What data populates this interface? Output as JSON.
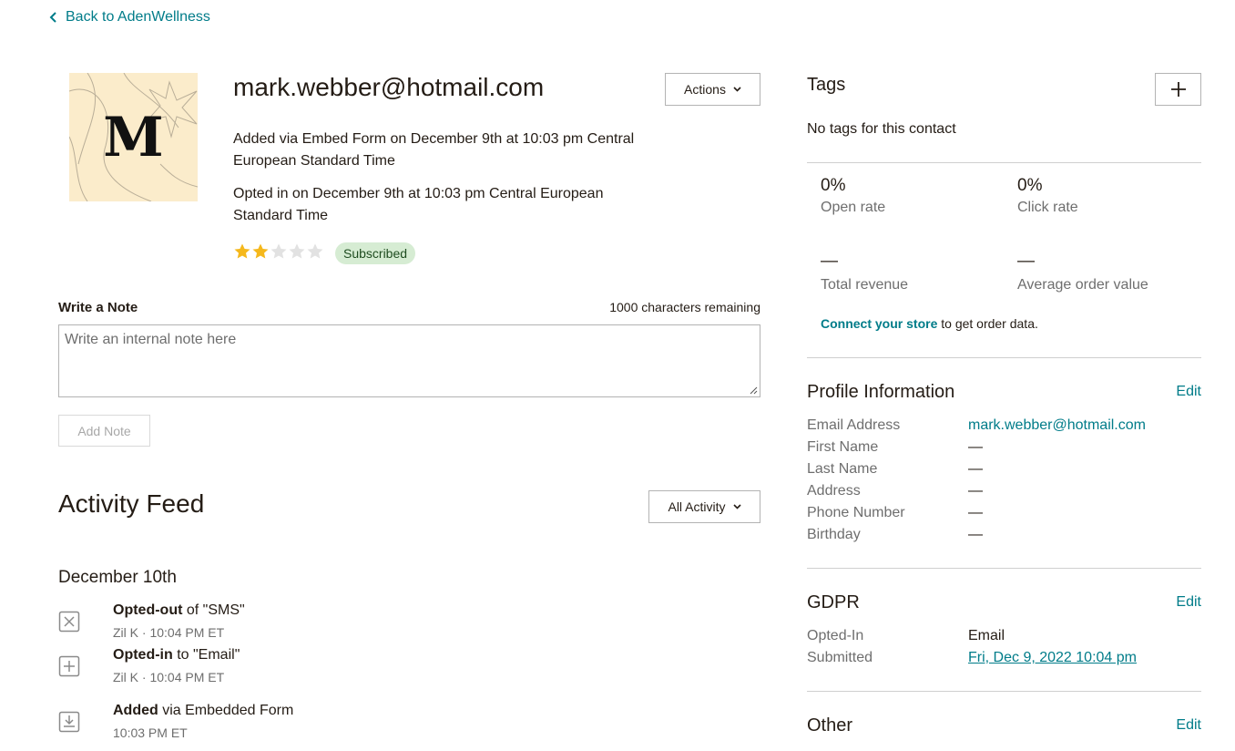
{
  "back_link": "Back to AdenWellness",
  "avatar": {
    "letter": "M"
  },
  "contact": {
    "email": "mark.webber@hotmail.com",
    "added_text": "Added via Embed Form on December 9th at 10:03 pm Central European Standard Time",
    "optin_text": "Opted in on December 9th at 10:03 pm Central European Standard Time",
    "rating": 2,
    "rating_max": 5,
    "status_badge": "Subscribed"
  },
  "actions_label": "Actions",
  "note": {
    "label": "Write a Note",
    "chars_remaining": "1000 characters remaining",
    "placeholder": "Write an internal note here",
    "add_button": "Add Note"
  },
  "activity": {
    "title": "Activity Feed",
    "filter_label": "All Activity",
    "date_heading": "December 10th",
    "items": [
      {
        "icon": "x-box-icon",
        "bold": "Opted-out",
        "rest": " of \"SMS\"",
        "sub": "Zil K · 10:04 PM ET"
      },
      {
        "icon": "plus-box-icon",
        "bold": "Opted-in",
        "rest": " to \"Email\"",
        "sub": "Zil K · 10:04 PM ET"
      },
      {
        "icon": "download-box-icon",
        "bold": "Added",
        "rest": " via Embedded Form",
        "sub": "10:03 PM ET"
      }
    ]
  },
  "tags": {
    "title": "Tags",
    "empty_text": "No tags for this contact"
  },
  "stats": {
    "open_rate": {
      "value": "0%",
      "label": "Open rate"
    },
    "click_rate": {
      "value": "0%",
      "label": "Click rate"
    },
    "total_revenue": {
      "value": "—",
      "label": "Total revenue"
    },
    "avg_order": {
      "value": "—",
      "label": "Average order value"
    },
    "connect_link": "Connect your store",
    "connect_rest": " to get order data."
  },
  "profile": {
    "title": "Profile Information",
    "edit": "Edit",
    "fields": [
      {
        "label": "Email Address",
        "value": "mark.webber@hotmail.com"
      },
      {
        "label": "First Name",
        "value": "—"
      },
      {
        "label": "Last Name",
        "value": "—"
      },
      {
        "label": "Address",
        "value": "—"
      },
      {
        "label": "Phone Number",
        "value": "—"
      },
      {
        "label": "Birthday",
        "value": "—"
      }
    ]
  },
  "gdpr": {
    "title": "GDPR",
    "edit": "Edit",
    "opted_in_label": "Opted-In",
    "opted_in_value": "Email",
    "submitted_label": "Submitted",
    "submitted_value": "Fri, Dec 9, 2022 10:04 pm"
  },
  "other": {
    "title": "Other",
    "edit": "Edit"
  },
  "colors": {
    "accent": "#007c89",
    "badge_bg": "#d6ecd3",
    "star": "#f5b81c",
    "avatar_bg": "#fbeccb"
  }
}
